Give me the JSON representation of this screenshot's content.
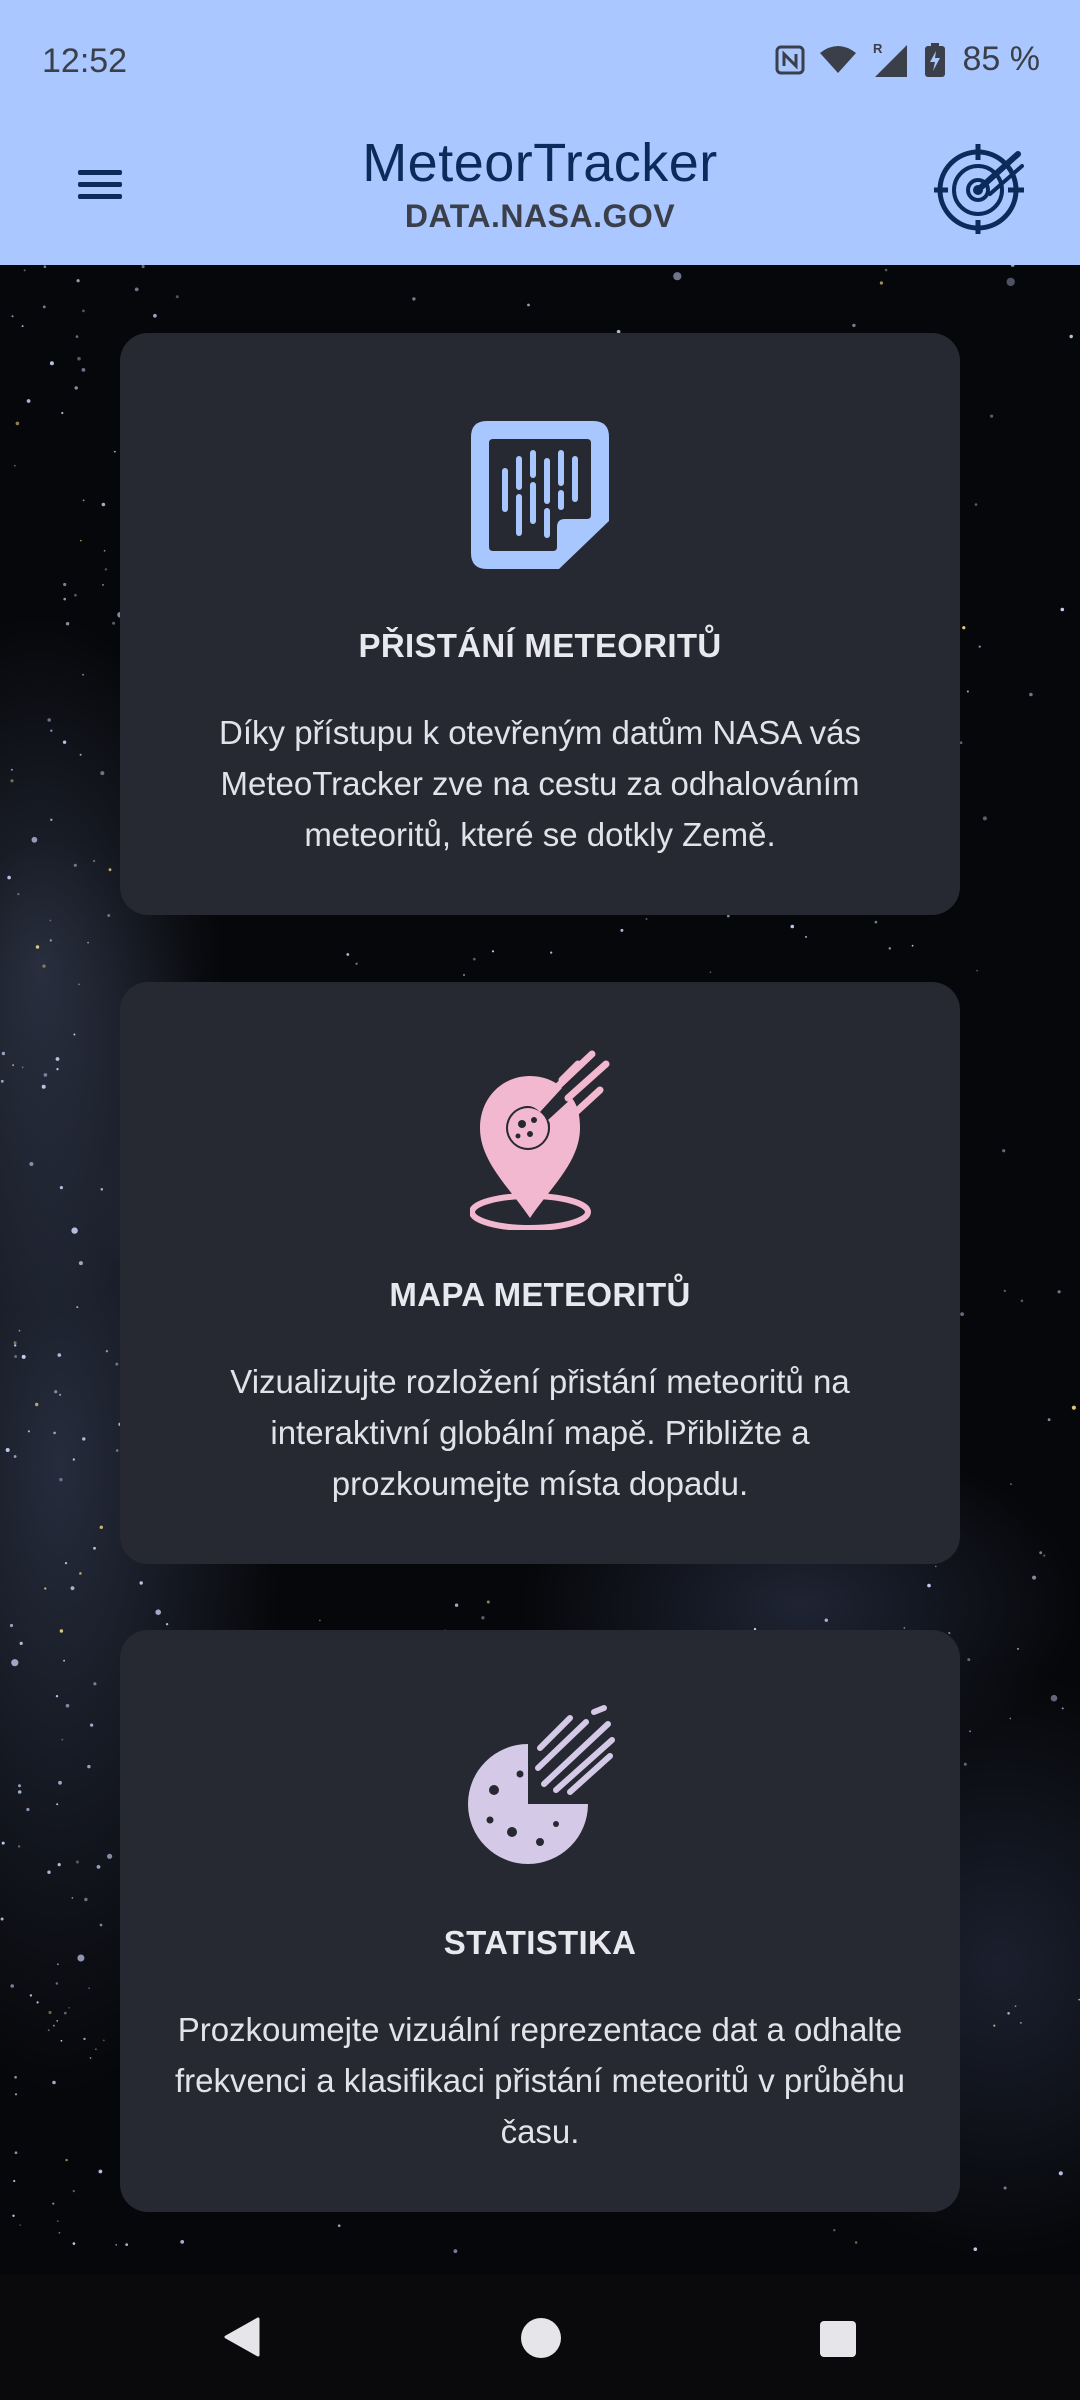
{
  "status_bar": {
    "time": "12:52",
    "battery": "85 %",
    "icons": [
      "nfc-icon",
      "wifi-icon",
      "signal-roaming-icon",
      "battery-charging-icon"
    ]
  },
  "app_bar": {
    "title": "MeteorTracker",
    "subtitle": "DATA.NASA.GOV",
    "left_icon": "menu-icon",
    "right_icon": "meteor-radar-icon"
  },
  "cards": [
    {
      "icon": "meteorite-landings-icon",
      "icon_color": "#a9c7ff",
      "title": "PŘISTÁNÍ METEORITŮ",
      "description": "Díky přístupu k otevřeným datům NASA vás MeteoTracker zve na cestu za odhalováním meteoritů, které se dotkly Země."
    },
    {
      "icon": "meteor-map-pin-icon",
      "icon_color": "#f2b8d0",
      "title": "MAPA METEORITŮ",
      "description": "Vizualizujte rozložení přistání meteoritů na interaktivní globální mapě. Přibližte a prozkoumejte místa dopadu."
    },
    {
      "icon": "meteor-pie-chart-icon",
      "icon_color": "#d4c9e6",
      "title": "STATISTIKA",
      "description": "Prozkoumejte vizuální reprezentace dat a odhalte frekvenci a klasifikaci přistání meteoritů v průběhu času."
    }
  ],
  "colors": {
    "app_bar": "#aac7ff",
    "card_bg": "#272932",
    "title_text": "#0b2b5b"
  },
  "nav_bar": {
    "buttons": [
      "back-icon",
      "home-icon",
      "recents-icon"
    ]
  }
}
